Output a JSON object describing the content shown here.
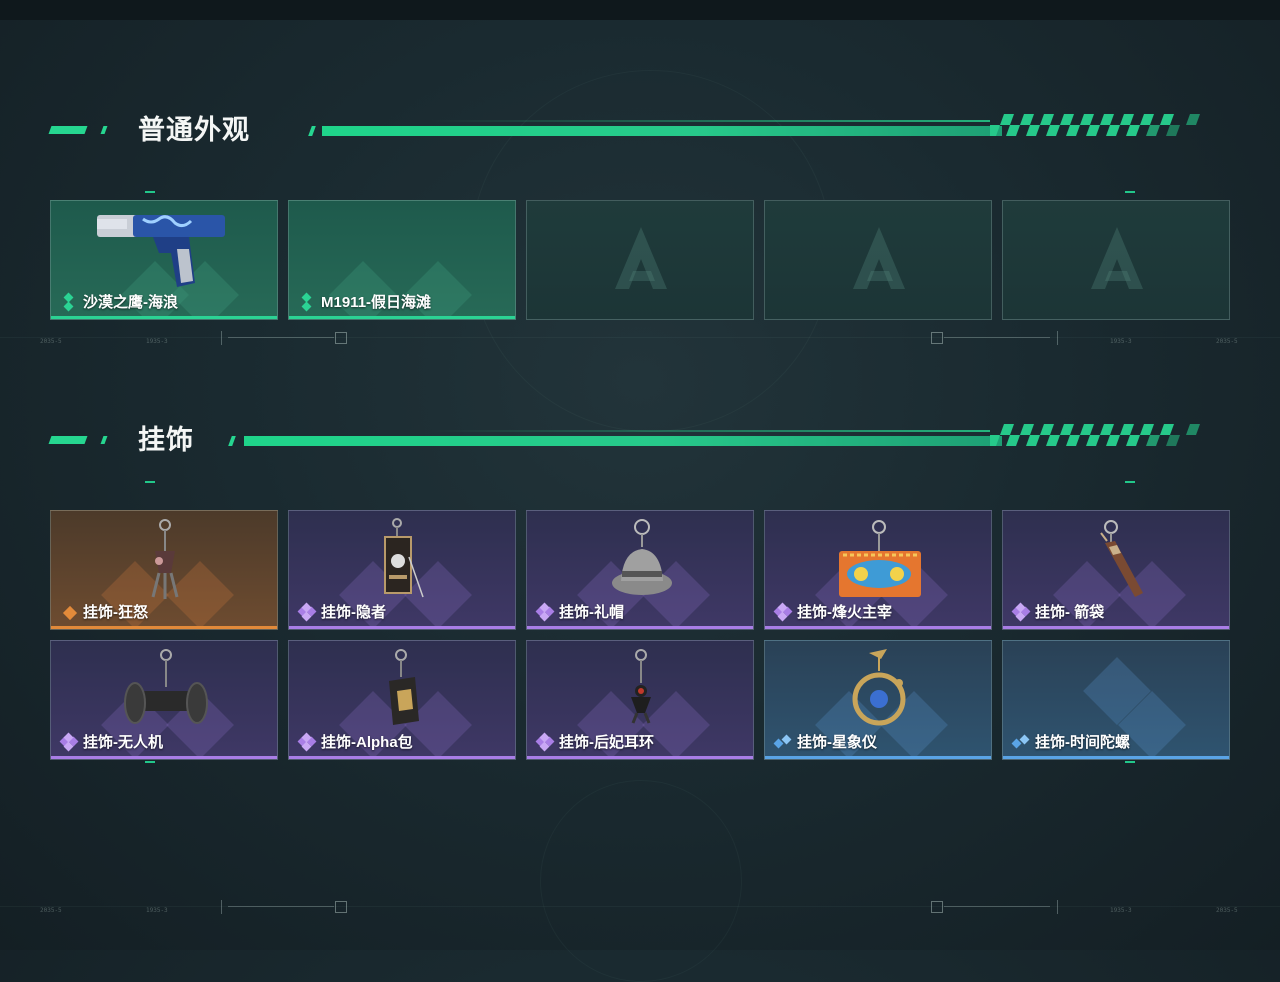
{
  "sections": [
    {
      "title": "普通外观",
      "items": [
        {
          "label": "沙漠之鹰-海浪",
          "rarity": "green",
          "icon": "desert-eagle-pistol-icon"
        },
        {
          "label": "M1911-假日海滩",
          "rarity": "green",
          "icon": "m1911-pistol-icon"
        },
        {
          "label": "",
          "rarity": "empty",
          "icon": "empty-slot-logo-icon"
        },
        {
          "label": "",
          "rarity": "empty",
          "icon": "empty-slot-logo-icon"
        },
        {
          "label": "",
          "rarity": "empty",
          "icon": "empty-slot-logo-icon"
        }
      ]
    },
    {
      "title": "挂饰",
      "items": [
        {
          "label": "挂饰-狂怒",
          "rarity": "orange",
          "icon": "rage-charm-icon"
        },
        {
          "label": "挂饰-隐者",
          "rarity": "purple",
          "icon": "hermit-card-charm-icon"
        },
        {
          "label": "挂饰-礼帽",
          "rarity": "purple",
          "icon": "top-hat-charm-icon"
        },
        {
          "label": "挂饰-烽火主宰",
          "rarity": "purple",
          "icon": "beacon-ruler-charm-icon"
        },
        {
          "label": "挂饰- 箭袋",
          "rarity": "purple",
          "icon": "quiver-charm-icon"
        },
        {
          "label": "挂饰-无人机",
          "rarity": "purple",
          "icon": "drone-charm-icon"
        },
        {
          "label": "挂饰-Alpha包",
          "rarity": "purple",
          "icon": "alpha-bag-charm-icon"
        },
        {
          "label": "挂饰-后妃耳环",
          "rarity": "purple",
          "icon": "consort-earring-charm-icon"
        },
        {
          "label": "挂饰-星象仪",
          "rarity": "blue",
          "icon": "astrolabe-charm-icon"
        },
        {
          "label": "挂饰-时间陀螺",
          "rarity": "blue",
          "icon": "time-gyroscope-charm-icon"
        }
      ]
    }
  ],
  "colors": {
    "accent": "#26d690",
    "green": "#2bd394",
    "orange": "#e28a3a",
    "purple": "#a97ee6",
    "blue": "#5aa4e6"
  }
}
